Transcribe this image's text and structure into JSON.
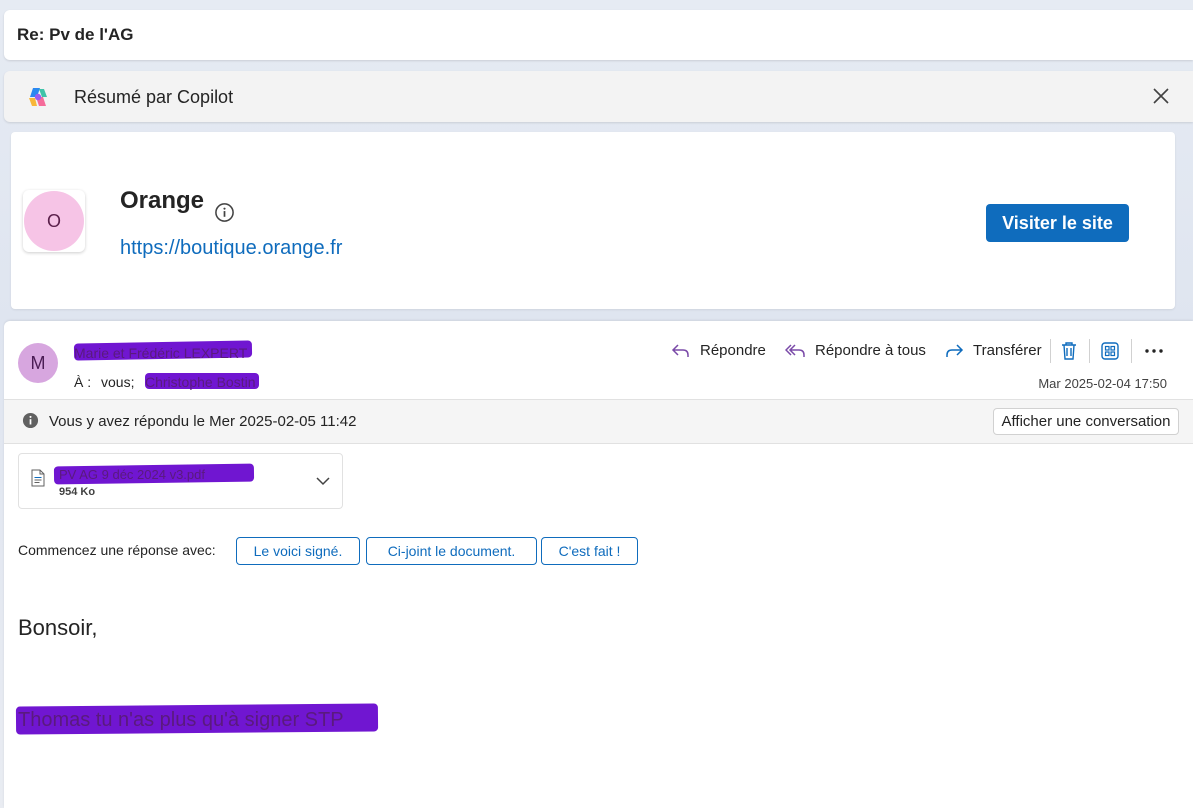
{
  "subject": "Re: Pv de l'AG",
  "copilot": {
    "title": "Résumé par Copilot",
    "close_icon": "close-icon",
    "logo_icon": "copilot-logo-icon"
  },
  "sender_card": {
    "avatar_letter": "O",
    "name": "Orange",
    "url": "https://boutique.orange.fr",
    "visit_label": "Visiter le site",
    "accent": "#0f6cbd"
  },
  "message": {
    "avatar_letter": "M",
    "from": "Marie et Frédéric LEXPERT",
    "to_label": "À :",
    "to_you": "vous;",
    "cc": "Christophe Bostin",
    "date": "Mar 2025-02-04 17:50",
    "actions": {
      "reply": "Répondre",
      "reply_all": "Répondre à tous",
      "forward": "Transférer"
    },
    "replied_notice": "Vous y avez répondu le Mer 2025-02-05 11:42",
    "show_conversation": "Afficher une conversation",
    "attachment": {
      "name": "PV AG 9 déc 2024 v3.pdf",
      "size": "954 Ko"
    },
    "suggested_label": "Commencez une réponse avec:",
    "suggestions": [
      "Le voici signé.",
      "Ci-joint le document.",
      "C'est fait !"
    ],
    "greeting": "Bonsoir,",
    "body": "Thomas tu n'as plus qu'à signer STP",
    "redaction_color": "#6a0dcf"
  }
}
